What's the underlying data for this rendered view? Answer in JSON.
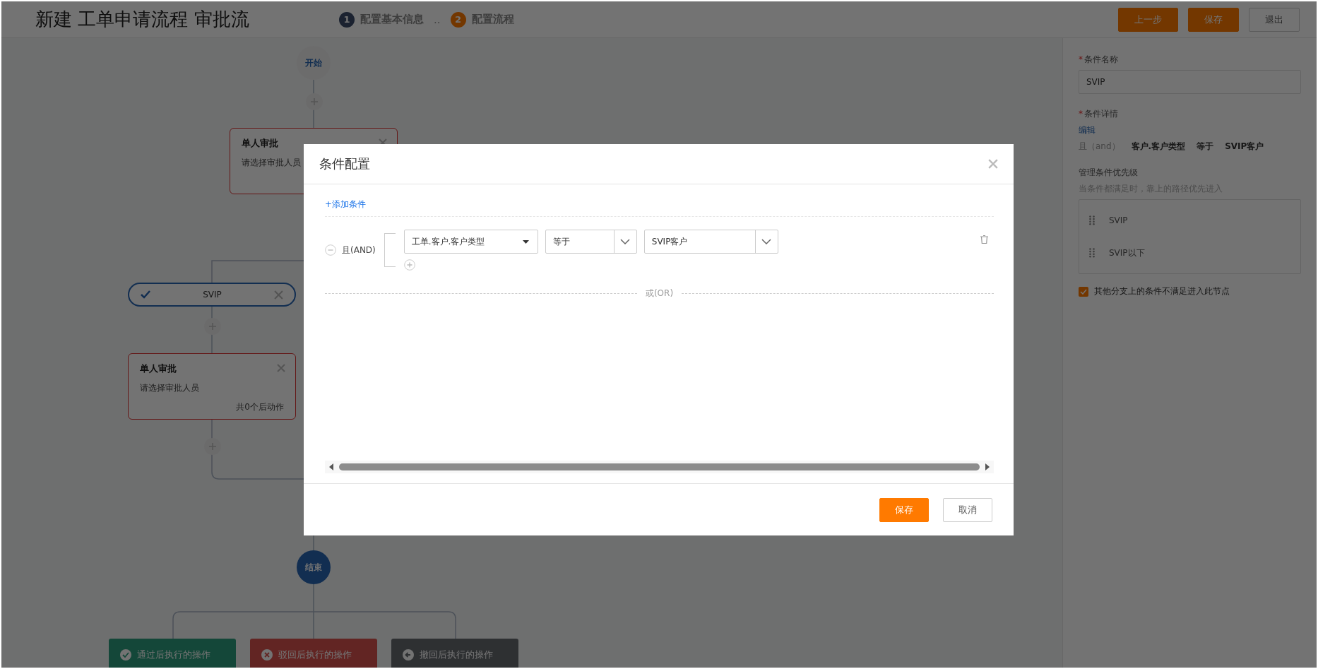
{
  "header": {
    "title": "新建 工单申请流程 审批流",
    "steps": [
      {
        "number": "1",
        "label": "配置基本信息",
        "selected": false
      },
      {
        "number": "2",
        "label": "配置流程",
        "selected": true
      }
    ],
    "step_separator": "..",
    "buttons": [
      {
        "label": "上一步",
        "kind": "primary"
      },
      {
        "label": "保存",
        "kind": "primary"
      },
      {
        "label": "退出",
        "kind": "default"
      }
    ]
  },
  "canvas": {
    "start": {
      "label": "开始"
    },
    "first_approval": {
      "title": "单人审批",
      "hint": "请选择审批人员"
    },
    "branch": {
      "condition": {
        "label": "SVIP",
        "selected": true
      },
      "approval": {
        "title": "单人审批",
        "hint": "请选择审批人员",
        "footer": "共0个后动作"
      }
    },
    "end": {
      "label": "结束"
    },
    "actions": [
      {
        "label": "通过后执行的操作",
        "kind": "approve"
      },
      {
        "label": "驳回后执行的操作",
        "kind": "reject"
      },
      {
        "label": "撤回后执行的操作",
        "kind": "withdraw"
      }
    ]
  },
  "side_panel": {
    "name_field": {
      "mark": "*",
      "label": "条件名称",
      "value": "SVIP"
    },
    "details": {
      "mark": "*",
      "label": "条件详情",
      "edit_link": "编辑",
      "summary": [
        "且（and）",
        "客户.客户类型",
        "等于",
        "SVIP客户"
      ]
    },
    "priority": {
      "label": "管理条件优先级",
      "hint": "当条件都满足时，靠上的路径优先进入",
      "items": [
        "SVIP",
        "SVIP以下"
      ]
    },
    "fallback": {
      "label": "其他分支上的条件不满足进入此节点",
      "checked": true
    }
  },
  "dialog": {
    "title": "条件配置",
    "add_condition": "+添加条件",
    "groups": [
      {
        "logic": "且(AND)",
        "conditions": [
          {
            "field": "工单.客户.客户类型",
            "operator": "等于",
            "value": "SVIP客户"
          }
        ]
      }
    ],
    "or_label": "或(OR)",
    "buttons": [
      {
        "label": "保存",
        "kind": "primary"
      },
      {
        "label": "取消",
        "kind": "default"
      }
    ]
  }
}
